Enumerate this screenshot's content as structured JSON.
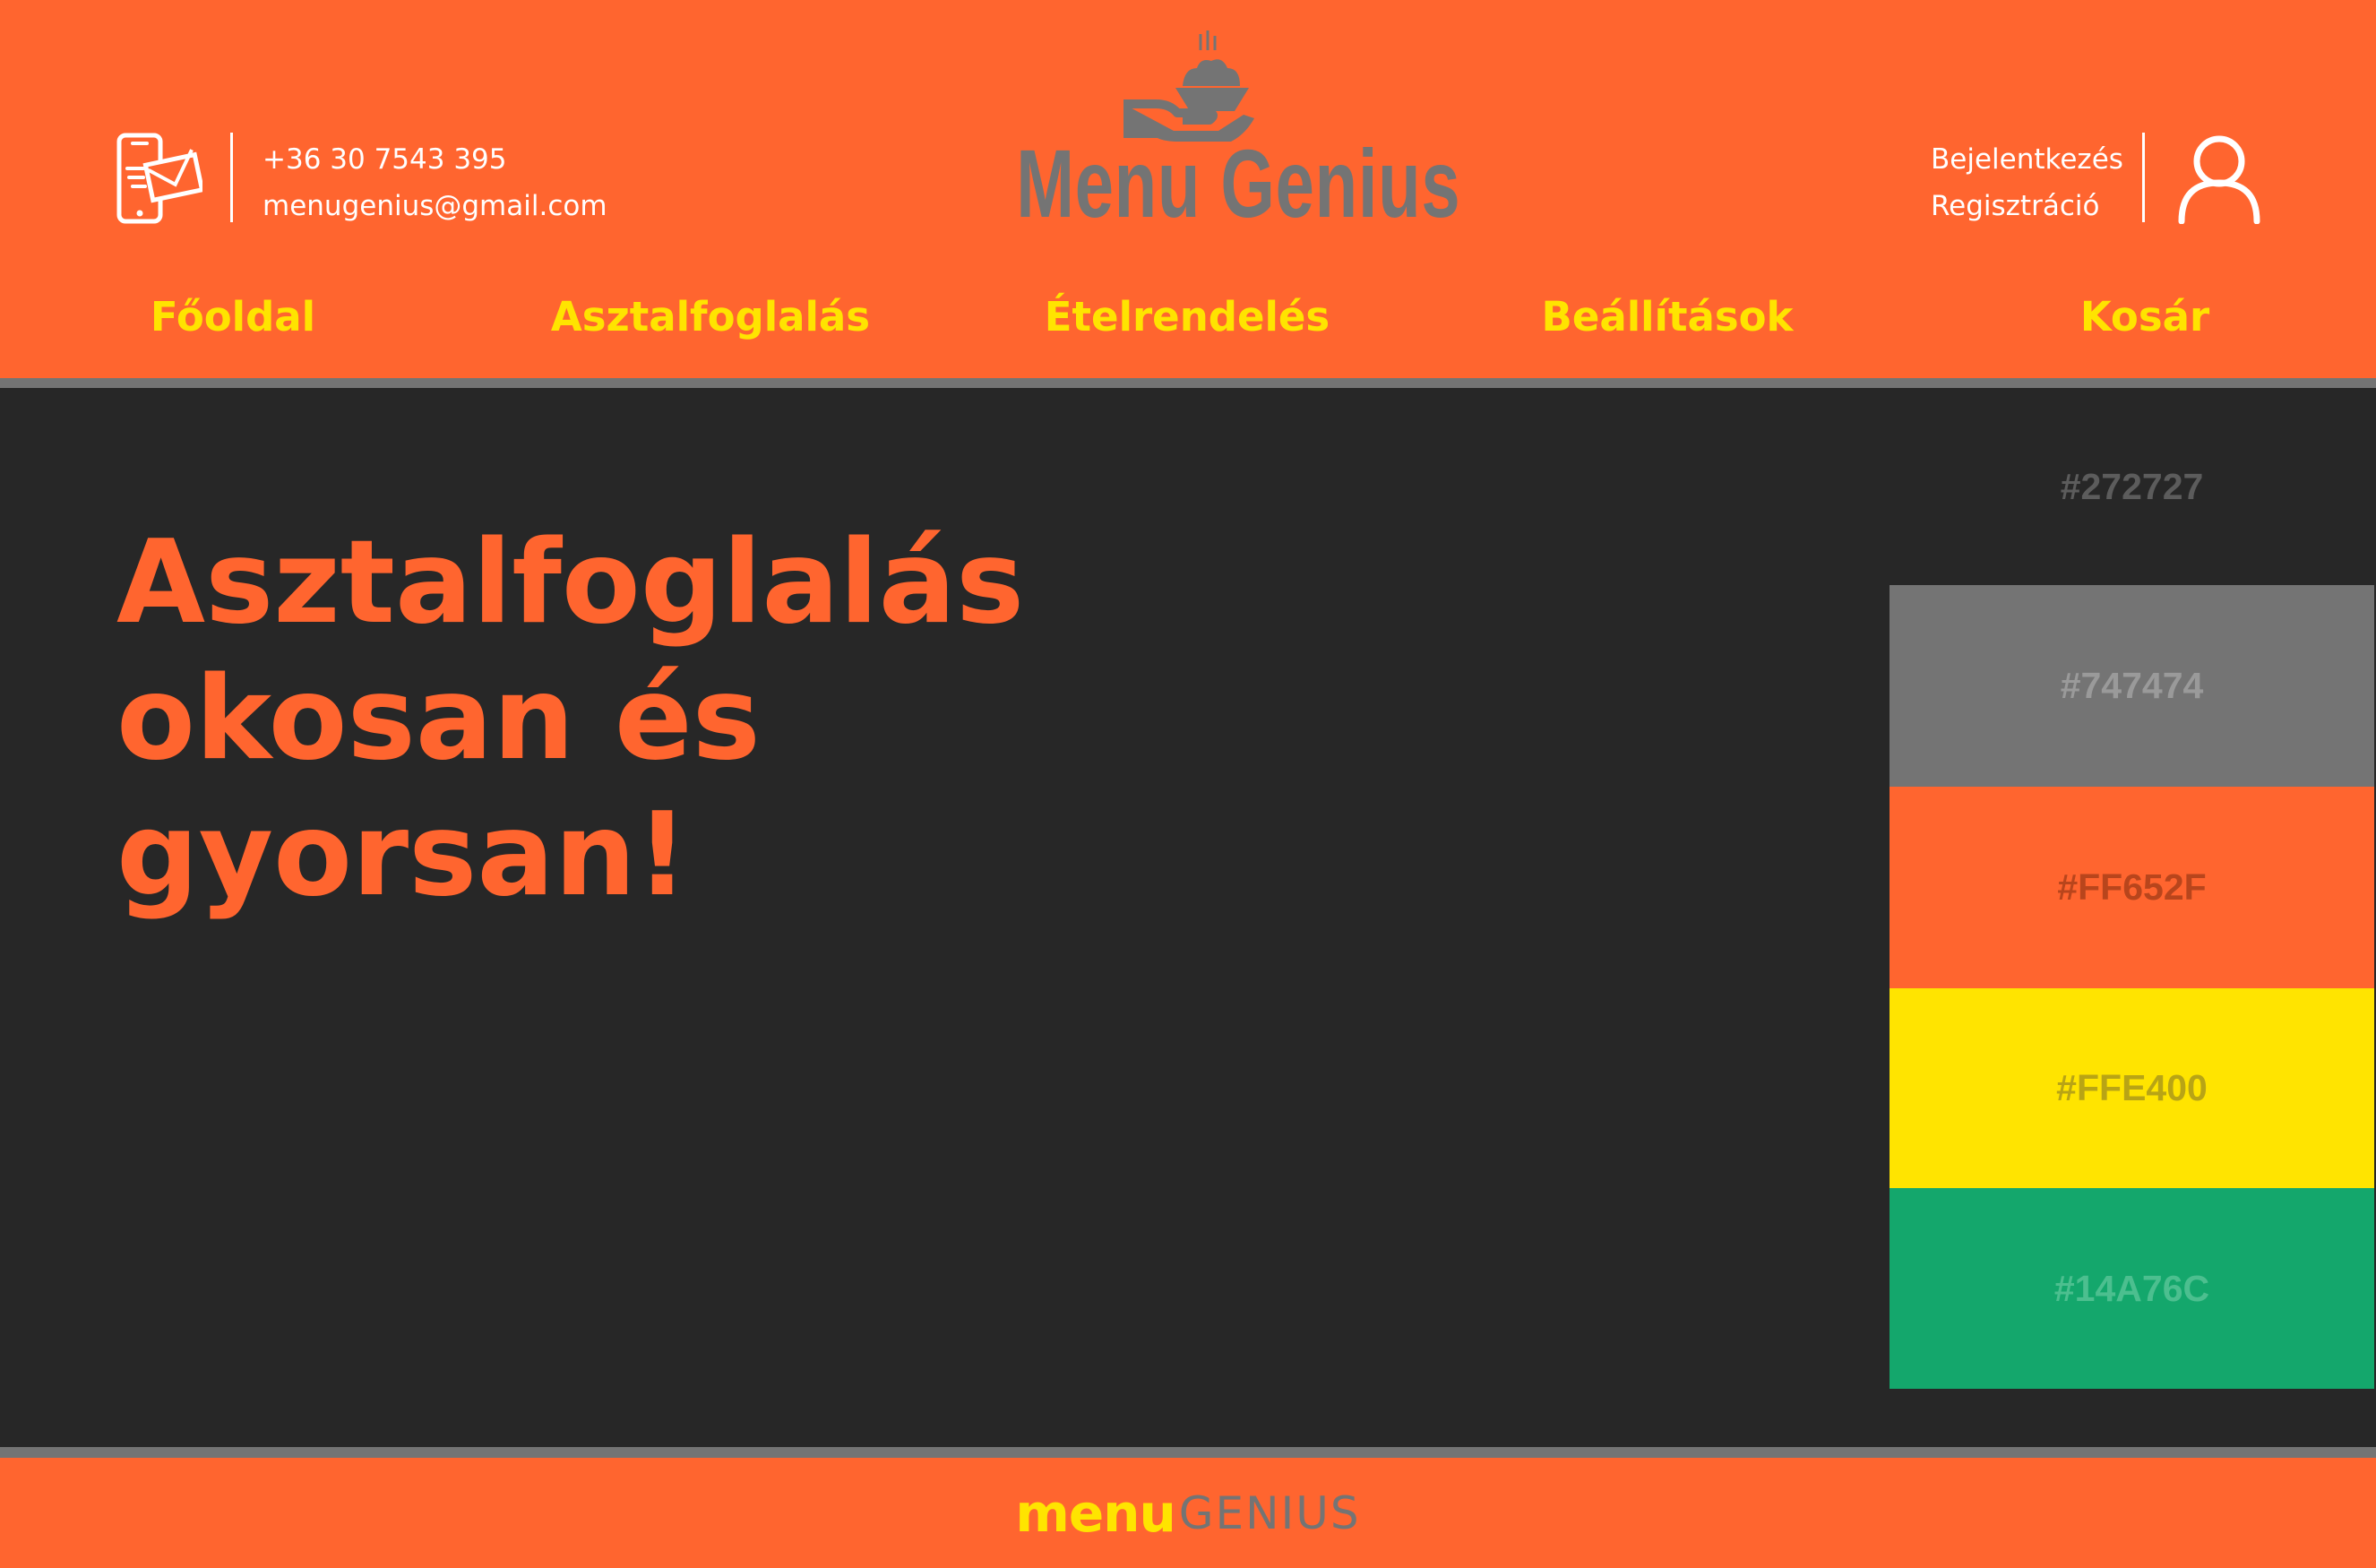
{
  "header": {
    "phone": "+36 30 7543 395",
    "email": "menugenius@gmail.com",
    "logo_title": "Menu Genius",
    "login_label": "Bejelentkezés",
    "register_label": "Regisztráció",
    "contact_icon": "phone-mail-icon",
    "logo_icon": "serving-dish-icon",
    "user_icon": "user-icon"
  },
  "nav": {
    "items": [
      {
        "label": "Főoldal"
      },
      {
        "label": "Asztalfoglalás"
      },
      {
        "label": "Ételrendelés"
      },
      {
        "label": "Beállítások"
      },
      {
        "label": "Kosár"
      }
    ]
  },
  "hero": {
    "lines": [
      "Asztalfoglalás",
      "okosan és",
      "gyorsan!"
    ]
  },
  "palette": {
    "swatches": [
      {
        "label": "#272727",
        "color": "#272727",
        "text_color": "#5c5c5c"
      },
      {
        "label": "#747474",
        "color": "#747474",
        "text_color": "#9a9a9a"
      },
      {
        "label": "#FF652F",
        "color": "#FF652F",
        "text_color": "#b8451c"
      },
      {
        "label": "#FFE400",
        "color": "#FFE400",
        "text_color": "#b8a415"
      },
      {
        "label": "#14A76C",
        "color": "#14A76C",
        "text_color": "#4cbf8f"
      }
    ]
  },
  "footer": {
    "logo_part1": "menu",
    "logo_part2": "GENIUS"
  },
  "colors": {
    "dark": "#272727",
    "gray": "#747474",
    "orange": "#FF652F",
    "yellow": "#FFE400",
    "green": "#14A76C",
    "white": "#ffffff"
  }
}
